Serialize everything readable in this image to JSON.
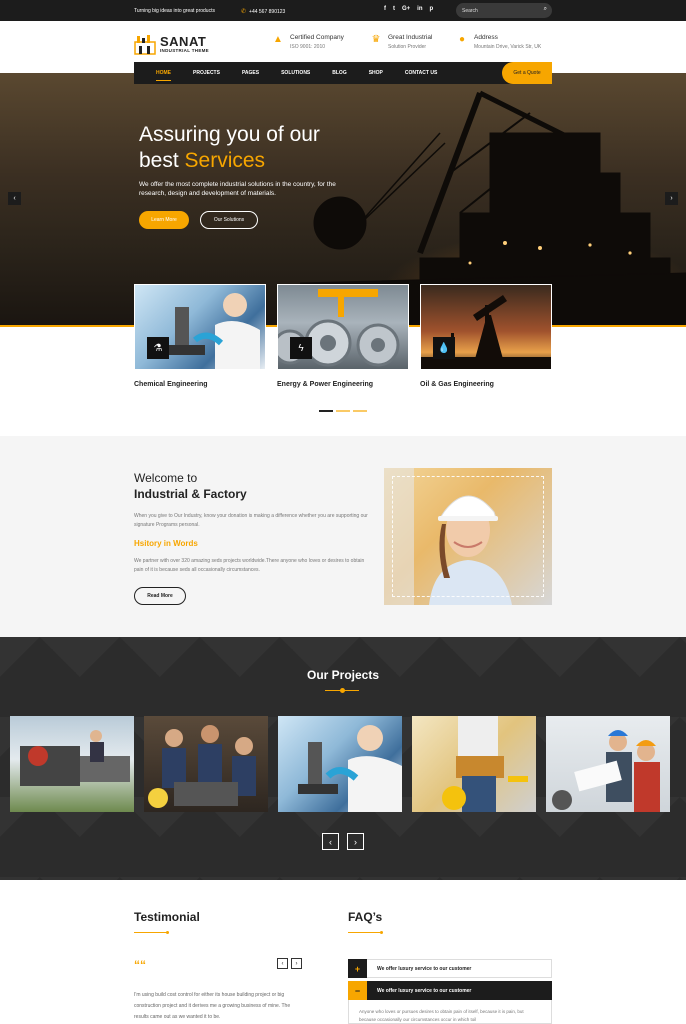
{
  "topbar": {
    "tagline": "Turning big ideas into great products",
    "phone": "+44 567 890123",
    "socials": [
      "f",
      "t",
      "G+",
      "in",
      "p"
    ],
    "search_placeholder": "Search"
  },
  "header": {
    "logo_name": "SANAT",
    "logo_sub": "INDUSTRIAL THEME",
    "info": [
      {
        "title": "Certified Company",
        "sub": "ISO 9001: 2010"
      },
      {
        "title": "Great Industrial",
        "sub": "Solution Provider"
      },
      {
        "title": "Address",
        "sub": "Mountain Drive, Varick Str, UK"
      }
    ]
  },
  "nav": {
    "items": [
      "HOME",
      "PROJECTS",
      "PAGES",
      "SOLUTIONS",
      "BLOG",
      "SHOP",
      "CONTACT US"
    ],
    "active": "HOME",
    "cta": "Get a Quote"
  },
  "hero": {
    "title_line1": "Assuring you of our",
    "title_line2_plain": "best ",
    "title_line2_highlight": "Services",
    "description": "We offer the most complete industrial solutions in the country, for the research, design and development of materials.",
    "btn_primary": "Learn More",
    "btn_secondary": "Our Solutions"
  },
  "services": [
    {
      "title": "Chemical Engineering",
      "icon": "flask-icon"
    },
    {
      "title": "Energy & Power Engineering",
      "icon": "bolt-icon"
    },
    {
      "title": "Oil & Gas Engineering",
      "icon": "drop-icon"
    }
  ],
  "welcome": {
    "heading_line1": "Welcome to",
    "heading_line2": "Industrial & Factory",
    "intro": "When you give to Our Industry, know your donation is making a difference whether you are supporting our signature Programs personal.",
    "subheading": "Hsitory in Words",
    "history": "We partner with over 320 amazing seds projects worldwide.There anyone who loves or desires to obtain pain of it is because seds all occasionally circumstances.",
    "button": "Read More"
  },
  "projects": {
    "title": "Our Projects"
  },
  "testimonial": {
    "title": "Testimonial",
    "quote_mark": "““",
    "text": "I'm using build cost control for either its house building project or big construction project and it derives me a growing business of mine. The results came out as we wanted it to be."
  },
  "faq": {
    "title": "FAQ’s",
    "items": [
      {
        "q": "We offer luxury service to our customer",
        "open": false
      },
      {
        "q": "We offer luxury service to our customer",
        "open": true
      }
    ],
    "answer": "Anyone who loves or pursues desires to obtain pain of itself, because it is pain, but because occasionally our circumstances occur in which toil"
  },
  "colors": {
    "accent": "#f7a600",
    "dark": "#1c1c1c"
  }
}
